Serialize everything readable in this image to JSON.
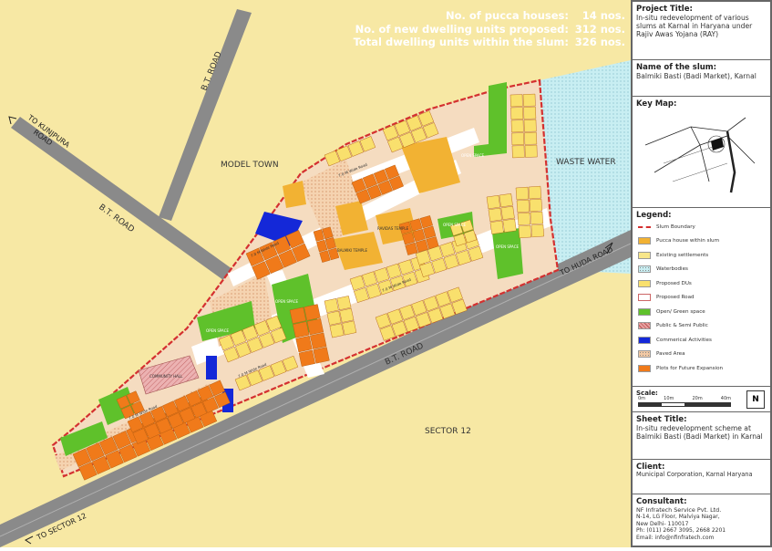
{
  "stats": [
    {
      "label": "No. of pucca houses:",
      "value": "14 nos."
    },
    {
      "label": "No. of new dwelling units proposed:",
      "value": "312 nos."
    },
    {
      "label": "Total dwelling units within the slum:",
      "value": "326 nos."
    }
  ],
  "map_labels": {
    "bt_road_top": "B.T. ROAD",
    "bt_road_left": "B.T. ROAD",
    "bt_road_bottom": "B.T. ROAD",
    "model_town": "MODEL TOWN",
    "waste_water": "WASTE WATER",
    "sector_12": "SECTOR 12",
    "to_kunjpura_line1": "TO KUNJPURA",
    "to_kunjpura_line2": "ROAD",
    "to_huda_road": "TO HUDA ROAD",
    "to_sector_12": "TO SECTOR 12",
    "open_space": "OPEN SPACE",
    "road_label": "7.0 M Wide Road",
    "balmiki_temple": "BALMIKI TEMPLE",
    "ravidas_temple": "RAVIDAS TEMPLE",
    "community_hall": "COMMUNITY HALL"
  },
  "panel": {
    "project_title_heading": "Project Title:",
    "project_title_text": "In-situ redevelopment of various slums at Karnal in Haryana under Rajiv Awas Yojana (RAY)",
    "slum_heading": "Name of the slum:",
    "slum_text": "Balmiki Basti (Badi Market), Karnal",
    "keymap_heading": "Key Map:",
    "legend_heading": "Legend:",
    "legend": [
      {
        "label": "Slum Boundary",
        "color": "#d43030",
        "kind": "boundary"
      },
      {
        "label": "Pucca house within slum",
        "color": "#f2b233",
        "kind": "fill"
      },
      {
        "label": "Existing settlements",
        "color": "#f7e68a",
        "kind": "fill"
      },
      {
        "label": "Waterbodies",
        "color": "#c8eef2",
        "kind": "dots"
      },
      {
        "label": "Proposed DUs",
        "color": "#f9e06d",
        "kind": "fill"
      },
      {
        "label": "Proposed Road",
        "color": "#ffffff",
        "kind": "road"
      },
      {
        "label": "Open/ Green space",
        "color": "#5fc12b",
        "kind": "fill"
      },
      {
        "label": "Public & Semi Public",
        "color": "#e8a0a0",
        "kind": "hatch"
      },
      {
        "label": "Commerical Activities",
        "color": "#1428d8",
        "kind": "fill"
      },
      {
        "label": "Paved Area",
        "color": "#f3c9a4",
        "kind": "dots"
      },
      {
        "label": "Plots for Future Expansion",
        "color": "#f07a1a",
        "kind": "fill"
      }
    ],
    "scale_heading": "Scale:",
    "scale_ticks": [
      "0m",
      "10m",
      "20m",
      "40m"
    ],
    "north": "N",
    "sheet_heading": "Sheet Title:",
    "sheet_text": "In-situ redevelopment scheme at Balmiki Basti (Badi Market) in Karnal",
    "client_heading": "Client:",
    "client_text": "Municipal Corporation, Karnal Haryana",
    "consultant_heading": "Consultant:",
    "consultant_name": "NF Infratech Service Pvt. Ltd.",
    "consultant_addr1": "N-14, LG Floor, Malviya Nagar,",
    "consultant_addr2": "New Delhi- 110017",
    "consultant_phone": "Ph: (011) 2667 3095, 2668 2201",
    "consultant_email": "Email: info@nfinfratech.com"
  }
}
